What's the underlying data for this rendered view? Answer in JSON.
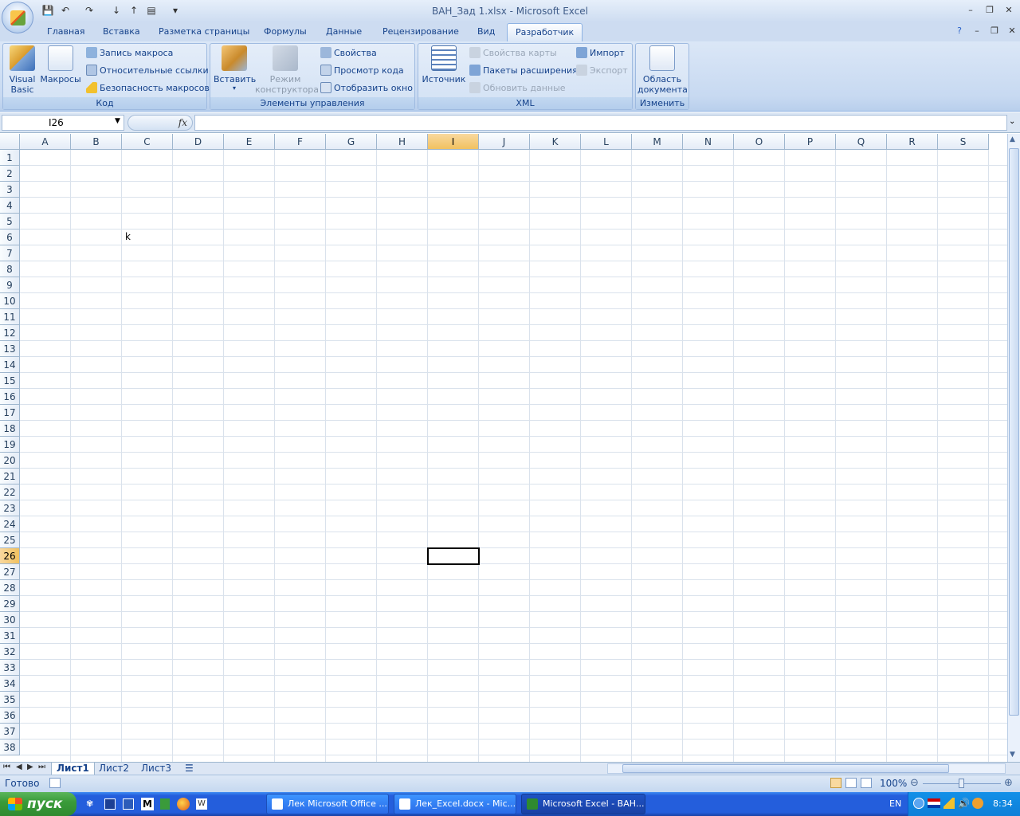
{
  "window": {
    "title": "ВАН_Зад 1.xlsx - Microsoft Excel"
  },
  "ribbon_tabs": [
    "Главная",
    "Вставка",
    "Разметка страницы",
    "Формулы",
    "Данные",
    "Рецензирование",
    "Вид",
    "Разработчик"
  ],
  "active_tab": "Разработчик",
  "groups": {
    "code": {
      "label": "Код",
      "visual_basic": "Visual\nBasic",
      "macros": "Макросы",
      "record_macro": "Запись макроса",
      "relative_refs": "Относительные ссылки",
      "macro_security": "Безопасность макросов"
    },
    "controls": {
      "label": "Элементы управления",
      "insert": "Вставить",
      "design_mode": "Режим\nконструктора",
      "properties": "Свойства",
      "view_code": "Просмотр кода",
      "run_dialog": "Отобразить окно"
    },
    "xml": {
      "label": "XML",
      "source": "Источник",
      "map_properties": "Свойства карты",
      "expansion_packs": "Пакеты расширения",
      "refresh_data": "Обновить данные",
      "import": "Импорт",
      "export": "Экспорт"
    },
    "modify": {
      "label": "Изменить",
      "document_panel": "Область\nдокумента"
    }
  },
  "formula_bar": {
    "name_box": "I26",
    "fx": "fx",
    "formula": ""
  },
  "columns": [
    "A",
    "B",
    "C",
    "D",
    "E",
    "F",
    "G",
    "H",
    "I",
    "J",
    "K",
    "L",
    "M",
    "N",
    "O",
    "P",
    "Q",
    "R",
    "S"
  ],
  "rows": [
    "1",
    "2",
    "3",
    "4",
    "5",
    "6",
    "7",
    "8",
    "9",
    "10",
    "11",
    "12",
    "13",
    "14",
    "15",
    "16",
    "17",
    "18",
    "19",
    "20",
    "21",
    "22",
    "23",
    "24",
    "25",
    "26",
    "27",
    "28",
    "29",
    "30",
    "31",
    "32",
    "33",
    "34",
    "35",
    "36",
    "37",
    "38"
  ],
  "selected_cell": {
    "column": "I",
    "row": "26"
  },
  "cells": [
    {
      "column": "C",
      "row": "6",
      "value": "k"
    }
  ],
  "sheet_tabs": [
    "Лист1",
    "Лист2",
    "Лист3"
  ],
  "active_sheet": "Лист1",
  "status": {
    "ready": "Готово",
    "zoom": "100%"
  },
  "taskbar": {
    "start": "пуск",
    "buttons": [
      "Лек Microsoft Office ...",
      "Лек_Excel.docx - Mic...",
      "Microsoft Excel - ВАН..."
    ],
    "active_button": "Microsoft Excel - ВАН...",
    "lang": "EN",
    "clock": "8:34"
  },
  "colors": {
    "accent": "#245edc",
    "ribbon": "#dbe7f7",
    "selection_header": "#f1c15f"
  }
}
